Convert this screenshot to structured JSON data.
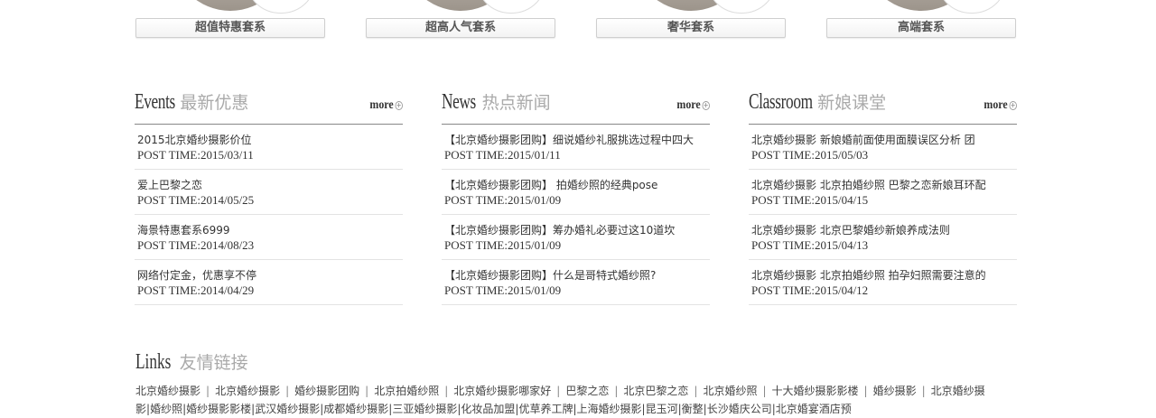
{
  "packages": [
    {
      "label": "超值特惠套系"
    },
    {
      "label": "超高人气套系"
    },
    {
      "label": "奢华套系"
    },
    {
      "label": "高端套系"
    }
  ],
  "columns": [
    {
      "title_en": "Events",
      "title_cn": "最新优惠",
      "more": "more",
      "items": [
        {
          "title": "2015北京婚纱摄影价位",
          "date": "POST TIME:2015/03/11"
        },
        {
          "title": "爱上巴黎之恋",
          "date": "POST TIME:2014/05/25"
        },
        {
          "title": "海景特惠套系6999",
          "date": "POST TIME:2014/08/23"
        },
        {
          "title": "网络付定金，优惠享不停",
          "date": "POST TIME:2014/04/29"
        }
      ]
    },
    {
      "title_en": "News",
      "title_cn": "热点新闻",
      "more": "more",
      "items": [
        {
          "title": "【北京婚纱摄影团购】细说婚纱礼服挑选过程中四大",
          "date": "POST TIME:2015/01/11"
        },
        {
          "title": "【北京婚纱摄影团购】 拍婚纱照的经典pose",
          "date": "POST TIME:2015/01/09"
        },
        {
          "title": "【北京婚纱摄影团购】筹办婚礼必要过这10道坎",
          "date": "POST TIME:2015/01/09"
        },
        {
          "title": "【北京婚纱摄影团购】什么是哥特式婚纱照?",
          "date": "POST TIME:2015/01/09"
        }
      ]
    },
    {
      "title_en": "Classroom",
      "title_cn": "新娘课堂",
      "more": "more",
      "items": [
        {
          "title": "北京婚纱摄影 新娘婚前面使用面膜误区分析 团",
          "date": "POST TIME:2015/05/03"
        },
        {
          "title": "北京婚纱摄影 北京拍婚纱照 巴黎之恋新娘耳环配",
          "date": "POST TIME:2015/04/15"
        },
        {
          "title": "北京婚纱摄影 北京巴黎婚纱新娘养成法则",
          "date": "POST TIME:2015/04/13"
        },
        {
          "title": "北京婚纱摄影 北京拍婚纱照 拍孕妇照需要注意的",
          "date": "POST TIME:2015/04/12"
        }
      ]
    }
  ],
  "links": {
    "title_en": "Links",
    "title_cn": "友情链接",
    "row1": [
      "北京婚纱摄影",
      "北京婚纱摄影",
      "婚纱摄影团购",
      "北京拍婚纱照",
      "北京婚纱摄影哪家好",
      "巴黎之恋",
      "北京巴黎之恋",
      "北京婚纱照",
      "十大婚纱摄影影楼",
      "婚纱摄影",
      "北京婚纱摄"
    ],
    "row2": [
      "影",
      "婚纱照",
      "婚纱摄影影楼",
      "武汉婚纱摄影",
      "成都婚纱摄影",
      "三亚婚纱摄影",
      "化妆品加盟",
      "优草养工牌",
      "上海婚纱摄影",
      "昆玉河",
      "衡整",
      "长沙婚庆公司",
      "北京婚宴酒店预"
    ]
  }
}
